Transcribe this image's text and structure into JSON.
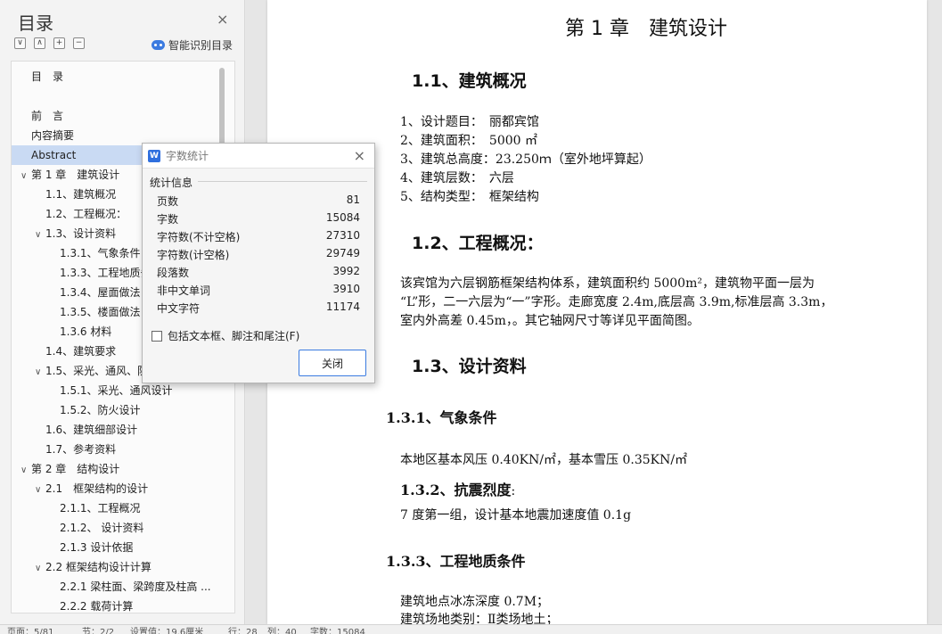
{
  "toc": {
    "title": "目录",
    "close": "×",
    "smart_label": "智能识别目录",
    "items": [
      {
        "label": "目　录",
        "indent": 0,
        "caret": ""
      },
      {
        "label": "前　言",
        "indent": 0,
        "caret": ""
      },
      {
        "label": "内容摘要",
        "indent": 0,
        "caret": ""
      },
      {
        "label": "Abstract",
        "indent": 0,
        "caret": "",
        "selected": true
      },
      {
        "label": "第 1 章　建筑设计",
        "indent": 0,
        "caret": "∨"
      },
      {
        "label": "1.1、建筑概况",
        "indent": 1,
        "caret": ""
      },
      {
        "label": "1.2、工程概况：",
        "indent": 1,
        "caret": ""
      },
      {
        "label": "1.3、设计资料",
        "indent": 1,
        "caret": "∨"
      },
      {
        "label": "1.3.1、气象条件",
        "indent": 2,
        "caret": ""
      },
      {
        "label": "1.3.3、工程地质条件",
        "indent": 2,
        "caret": ""
      },
      {
        "label": "1.3.4、屋面做法",
        "indent": 2,
        "caret": ""
      },
      {
        "label": "1.3.5、楼面做法",
        "indent": 2,
        "caret": ""
      },
      {
        "label": "1.3.6 材料",
        "indent": 2,
        "caret": ""
      },
      {
        "label": "1.4、建筑要求",
        "indent": 1,
        "caret": ""
      },
      {
        "label": "1.5、采光、通风、防火设计",
        "indent": 1,
        "caret": "∨"
      },
      {
        "label": "1.5.1、采光、通风设计",
        "indent": 2,
        "caret": ""
      },
      {
        "label": "1.5.2、防火设计",
        "indent": 2,
        "caret": ""
      },
      {
        "label": "1.6、建筑细部设计",
        "indent": 1,
        "caret": ""
      },
      {
        "label": "1.7、参考资料",
        "indent": 1,
        "caret": ""
      },
      {
        "label": "第 2 章　结构设计",
        "indent": 0,
        "caret": "∨"
      },
      {
        "label": "2.1　框架结构的设计",
        "indent": 1,
        "caret": "∨"
      },
      {
        "label": "2.1.1、工程概况",
        "indent": 2,
        "caret": ""
      },
      {
        "label": "2.1.2、 设计资料",
        "indent": 2,
        "caret": ""
      },
      {
        "label": "2.1.3 设计依据",
        "indent": 2,
        "caret": ""
      },
      {
        "label": "2.2 框架结构设计计算",
        "indent": 1,
        "caret": "∨"
      },
      {
        "label": "2.2.1 梁柱面、梁跨度及柱高 ...",
        "indent": 2,
        "caret": ""
      },
      {
        "label": "2.2.2 载荷计算",
        "indent": 2,
        "caret": ""
      }
    ]
  },
  "dialog": {
    "title": "字数统计",
    "logo": "W",
    "group": "统计信息",
    "rows": [
      {
        "label": "页数",
        "value": "81"
      },
      {
        "label": "字数",
        "value": "15084"
      },
      {
        "label": "字符数(不计空格)",
        "value": "27310"
      },
      {
        "label": "字符数(计空格)",
        "value": "29749"
      },
      {
        "label": "段落数",
        "value": "3992"
      },
      {
        "label": "非中文单词",
        "value": "3910"
      },
      {
        "label": "中文字符",
        "value": "11174"
      }
    ],
    "checkbox_label": "包括文本框、脚注和尾注(F)",
    "close_label": "关闭"
  },
  "doc": {
    "chapter": "第 1 章　建筑设计",
    "s11": "1.1、建筑概况",
    "list": [
      "1、设计题目：　丽都宾馆",
      "2、建筑面积：　5000 ㎡",
      "3、建筑总高度：23.250ｍ（室外地坪算起）",
      "4、建筑层数：　六层",
      "5、结构类型：　框架结构"
    ],
    "s12": "1.2、工程概况：",
    "para1": "该宾馆为六层钢筋框架结构体系，建筑面积约 5000m²，建筑物平面一层为",
    "para2": "“L”形，二一六层为“一”字形。走廊宽度 2.4m,底层高 3.9m,标准层高 3.3m，",
    "para3": "室内外高差 0.45m，。其它轴网尺寸等详见平面简图。",
    "s13": "1.3、设计资料",
    "s131": "1.3.1、气象条件",
    "wind": "本地区基本风压 0.40KN/㎡，基本雪压 0.35KN/㎡",
    "s132": "1.3.2、抗震烈度",
    "s132_colon": ":",
    "quake": "7 度第一组，设计基本地震加速度值 0.1g",
    "s133": "1.3.3、工程地质条件",
    "geo1": "建筑地点冰冻深度 0.7M；",
    "geo2": "建筑场地类别：Ⅱ类场地土；"
  },
  "status": {
    "page": "页面：5/81",
    "section": "节：2/2",
    "setting": "设置值：19.6厘米",
    "line": "行：28",
    "col": "列：40",
    "words": "字数：15084"
  }
}
